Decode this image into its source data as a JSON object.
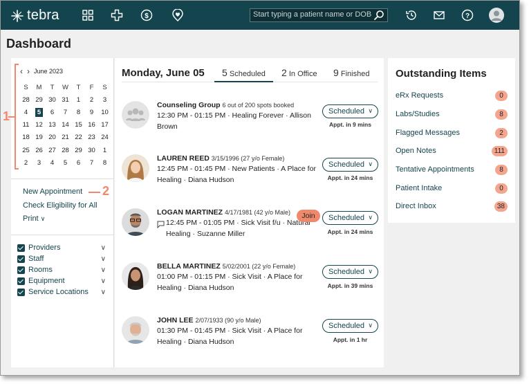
{
  "app": {
    "brand": "tebra",
    "search_placeholder": "Start typing a patient name or DOB",
    "page_title": "Dashboard"
  },
  "nav_icons": [
    "grid-icon",
    "medical-cross-icon",
    "dollar-icon",
    "heart-pin-icon",
    "history-icon",
    "mail-icon",
    "help-icon",
    "user-avatar-icon"
  ],
  "calendar": {
    "month_label": "June 2023",
    "weekdays": [
      "S",
      "M",
      "T",
      "W",
      "T",
      "F",
      "S"
    ],
    "weeks": [
      [
        "28",
        "29",
        "30",
        "31",
        "1",
        "2",
        "3"
      ],
      [
        "4",
        "5",
        "6",
        "7",
        "8",
        "9",
        "10"
      ],
      [
        "11",
        "12",
        "13",
        "14",
        "15",
        "16",
        "17"
      ],
      [
        "18",
        "19",
        "20",
        "21",
        "22",
        "23",
        "24"
      ],
      [
        "25",
        "26",
        "27",
        "28",
        "29",
        "30",
        "1"
      ],
      [
        "2",
        "3",
        "4",
        "5",
        "6",
        "7",
        "8"
      ]
    ],
    "today": "5"
  },
  "annotations": {
    "one": "1",
    "two": "2"
  },
  "left_links": {
    "new_appointment": "New Appointment",
    "check_eligibility": "Check Eligibility for All",
    "print": "Print"
  },
  "filters": [
    "Providers",
    "Staff",
    "Rooms",
    "Equipment",
    "Service Locations"
  ],
  "day": {
    "title": "Monday, June 05",
    "tabs": [
      {
        "count": "5",
        "label": "Scheduled"
      },
      {
        "count": "2",
        "label": "In Office"
      },
      {
        "count": "9",
        "label": "Finished"
      }
    ]
  },
  "appointments": [
    {
      "name": "Counseling Group",
      "sub": "6 out of 200 spots booked",
      "desc": "12:30 PM - 01:15 PM · Healing Forever · Allison Brown",
      "status": "Scheduled",
      "time": "Appt. in 9 mins"
    },
    {
      "name": "LAUREN REED",
      "sub": "3/15/1996 (27 y/o Female)",
      "desc": "12:45 PM - 01:45 PM · New Patients · A Place for Healing · Diana Hudson",
      "status": "Scheduled",
      "time": "Appt. in 24 mins"
    },
    {
      "name": "LOGAN MARTINEZ",
      "sub": "4/17/1981 (42 y/o Male)",
      "desc": "12:45 PM - 01:05 PM · Sick Visit f/u · Natural Healing · Suzanne Miller",
      "status": "Scheduled",
      "time": "Appt. in 24 mins",
      "join": "Join"
    },
    {
      "name": "BELLA MARTINEZ",
      "sub": "5/02/2001 (22 y/o Female)",
      "desc": "01:00 PM - 01:15 PM · Sick Visit · A Place for Healing · Diana Hudson",
      "status": "Scheduled",
      "time": "Appt. in 39 mins"
    },
    {
      "name": "JOHN LEE",
      "sub": "2/07/1933 (90 y/o Male)",
      "desc": "01:30 PM - 01:45 PM · Sick Visit · A Place for Healing · Diana Hudson",
      "status": "Scheduled",
      "time": "Appt. in 1 hr"
    }
  ],
  "outstanding": {
    "title": "Outstanding Items",
    "items": [
      {
        "label": "eRx Requests",
        "count": "0"
      },
      {
        "label": "Labs/Studies",
        "count": "8"
      },
      {
        "label": "Flagged Messages",
        "count": "2"
      },
      {
        "label": "Open Notes",
        "count": "111"
      },
      {
        "label": "Tentative Appointments",
        "count": "8"
      },
      {
        "label": "Patient Intake",
        "count": "0"
      },
      {
        "label": "Direct Inbox",
        "count": "38"
      }
    ]
  },
  "colors": {
    "brand": "#14454e",
    "accent": "#f0896b",
    "badge": "#f4a58e"
  }
}
